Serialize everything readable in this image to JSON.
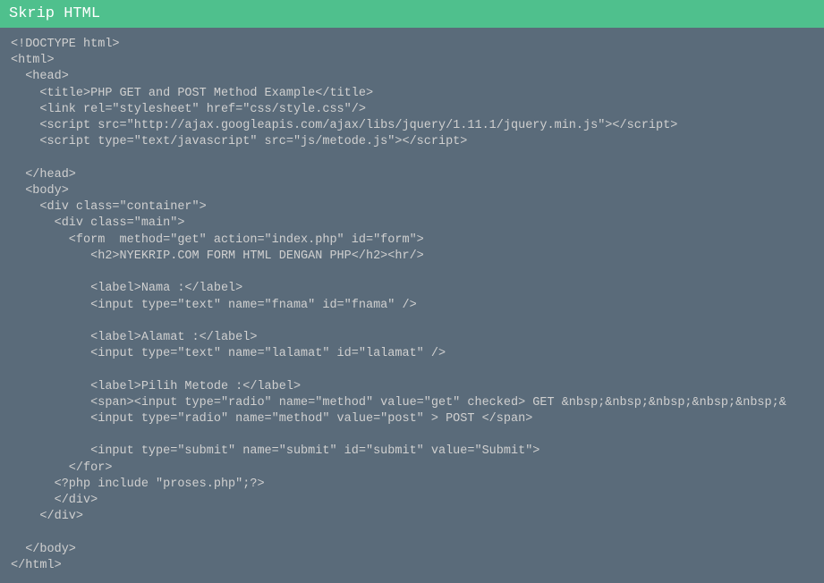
{
  "header": {
    "title": "Skrip HTML"
  },
  "code": {
    "lines": [
      "<!DOCTYPE html>",
      "<html>",
      "  <head>",
      "    <title>PHP GET and POST Method Example</title>",
      "    <link rel=\"stylesheet\" href=\"css/style.css\"/>",
      "    <script src=\"http://ajax.googleapis.com/ajax/libs/jquery/1.11.1/jquery.min.js\"></script>",
      "    <script type=\"text/javascript\" src=\"js/metode.js\"></script>",
      "",
      "  </head>",
      "  <body>",
      "    <div class=\"container\">",
      "      <div class=\"main\">",
      "        <form  method=\"get\" action=\"index.php\" id=\"form\">",
      "           <h2>NYEKRIP.COM FORM HTML DENGAN PHP</h2><hr/>",
      "",
      "           <label>Nama :</label>",
      "           <input type=\"text\" name=\"fnama\" id=\"fnama\" />",
      "",
      "           <label>Alamat :</label>",
      "           <input type=\"text\" name=\"lalamat\" id=\"lalamat\" />",
      "",
      "           <label>Pilih Metode :</label>",
      "           <span><input type=\"radio\" name=\"method\" value=\"get\" checked> GET &nbsp;&nbsp;&nbsp;&nbsp;&nbsp;&",
      "           <input type=\"radio\" name=\"method\" value=\"post\" > POST </span>",
      "",
      "           <input type=\"submit\" name=\"submit\" id=\"submit\" value=\"Submit\">",
      "        </for>",
      "      <?php include \"proses.php\";?>",
      "      </div>",
      "    </div>",
      "",
      "  </body>",
      "</html>"
    ]
  }
}
